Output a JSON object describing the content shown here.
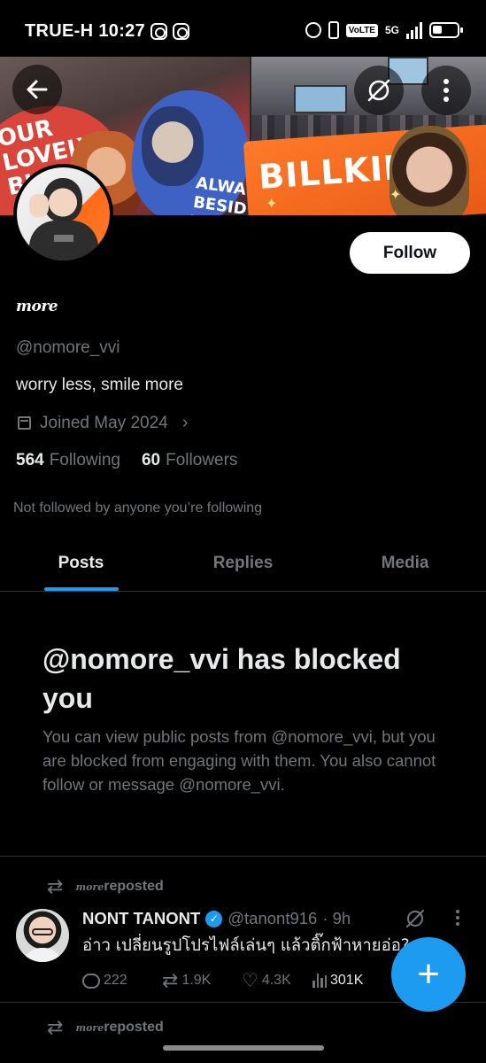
{
  "status_bar": {
    "carrier": "TRUE-H",
    "time": "10:27",
    "network": "5G",
    "volte": "VoLTE",
    "notification_icons": [
      "instagram-icon",
      "instagram-icon"
    ],
    "system_icons": [
      "alarm-icon",
      "vibrate-icon",
      "volte-icon",
      "signal-icon",
      "battery-icon"
    ]
  },
  "banner": {
    "sign_left": "OUR\nLOVELY\nBKPP",
    "sign_middle": "ALWA\nBESID\nYOU",
    "sign_right": "BILLKIN",
    "back_icon": "arrow-left-icon",
    "grok_icon": "grok-icon",
    "more_icon": "vertical-ellipsis-icon"
  },
  "profile": {
    "display_name": "more",
    "handle": "@nomore_vvi",
    "bio": "worry less, smile more",
    "joined": "Joined May 2024",
    "following_count": "564",
    "following_label": "Following",
    "followers_count": "60",
    "followers_label": "Followers",
    "not_followed_text": "Not followed by anyone you’re following",
    "follow_label": "Follow"
  },
  "tabs": [
    {
      "label": "Posts",
      "active": true
    },
    {
      "label": "Replies",
      "active": false
    },
    {
      "label": "Media",
      "active": false
    }
  ],
  "blocked": {
    "title": "@nomore_vvi has blocked you",
    "description": "You can view public posts from @nomore_vvi, but you are blocked from engaging with them. You also cannot follow or message @nomore_vvi."
  },
  "posts": [
    {
      "repost_by": "more",
      "repost_label": "reposted",
      "author_name": "NONT TANONT",
      "verified": true,
      "author_handle": "@tanont916",
      "time": "· 9h",
      "text": "อ่าว เปลี่ยนรูปโปรไฟล์เล่นๆ แล้วติ๊กฟ้าหายอ่อ?",
      "replies": "222",
      "reposts": "1.9K",
      "likes": "4.3K",
      "views": "301K"
    }
  ],
  "second_repost": {
    "repost_by": "more",
    "repost_label": "reposted"
  },
  "fab": {
    "icon": "plus-icon",
    "label": "+"
  },
  "colors": {
    "accent": "#1d9bf0",
    "background": "#000000",
    "text_primary": "#e7e9ea",
    "text_secondary": "#71767b",
    "divider": "#2f3336"
  }
}
